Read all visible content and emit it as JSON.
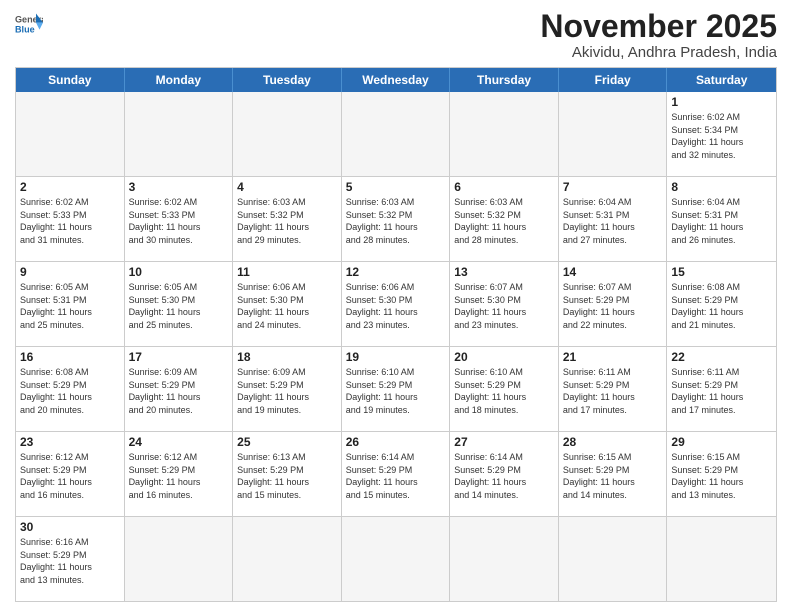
{
  "header": {
    "logo_general": "General",
    "logo_blue": "Blue",
    "month_title": "November 2025",
    "location": "Akividu, Andhra Pradesh, India"
  },
  "day_headers": [
    "Sunday",
    "Monday",
    "Tuesday",
    "Wednesday",
    "Thursday",
    "Friday",
    "Saturday"
  ],
  "weeks": [
    {
      "days": [
        {
          "num": "",
          "info": "",
          "empty": true
        },
        {
          "num": "",
          "info": "",
          "empty": true
        },
        {
          "num": "",
          "info": "",
          "empty": true
        },
        {
          "num": "",
          "info": "",
          "empty": true
        },
        {
          "num": "",
          "info": "",
          "empty": true
        },
        {
          "num": "",
          "info": "",
          "empty": true
        },
        {
          "num": "1",
          "info": "Sunrise: 6:02 AM\nSunset: 5:34 PM\nDaylight: 11 hours\nand 32 minutes."
        }
      ]
    },
    {
      "days": [
        {
          "num": "2",
          "info": "Sunrise: 6:02 AM\nSunset: 5:33 PM\nDaylight: 11 hours\nand 31 minutes."
        },
        {
          "num": "3",
          "info": "Sunrise: 6:02 AM\nSunset: 5:33 PM\nDaylight: 11 hours\nand 30 minutes."
        },
        {
          "num": "4",
          "info": "Sunrise: 6:03 AM\nSunset: 5:32 PM\nDaylight: 11 hours\nand 29 minutes."
        },
        {
          "num": "5",
          "info": "Sunrise: 6:03 AM\nSunset: 5:32 PM\nDaylight: 11 hours\nand 28 minutes."
        },
        {
          "num": "6",
          "info": "Sunrise: 6:03 AM\nSunset: 5:32 PM\nDaylight: 11 hours\nand 28 minutes."
        },
        {
          "num": "7",
          "info": "Sunrise: 6:04 AM\nSunset: 5:31 PM\nDaylight: 11 hours\nand 27 minutes."
        },
        {
          "num": "8",
          "info": "Sunrise: 6:04 AM\nSunset: 5:31 PM\nDaylight: 11 hours\nand 26 minutes."
        }
      ]
    },
    {
      "days": [
        {
          "num": "9",
          "info": "Sunrise: 6:05 AM\nSunset: 5:31 PM\nDaylight: 11 hours\nand 25 minutes."
        },
        {
          "num": "10",
          "info": "Sunrise: 6:05 AM\nSunset: 5:30 PM\nDaylight: 11 hours\nand 25 minutes."
        },
        {
          "num": "11",
          "info": "Sunrise: 6:06 AM\nSunset: 5:30 PM\nDaylight: 11 hours\nand 24 minutes."
        },
        {
          "num": "12",
          "info": "Sunrise: 6:06 AM\nSunset: 5:30 PM\nDaylight: 11 hours\nand 23 minutes."
        },
        {
          "num": "13",
          "info": "Sunrise: 6:07 AM\nSunset: 5:30 PM\nDaylight: 11 hours\nand 23 minutes."
        },
        {
          "num": "14",
          "info": "Sunrise: 6:07 AM\nSunset: 5:29 PM\nDaylight: 11 hours\nand 22 minutes."
        },
        {
          "num": "15",
          "info": "Sunrise: 6:08 AM\nSunset: 5:29 PM\nDaylight: 11 hours\nand 21 minutes."
        }
      ]
    },
    {
      "days": [
        {
          "num": "16",
          "info": "Sunrise: 6:08 AM\nSunset: 5:29 PM\nDaylight: 11 hours\nand 20 minutes."
        },
        {
          "num": "17",
          "info": "Sunrise: 6:09 AM\nSunset: 5:29 PM\nDaylight: 11 hours\nand 20 minutes."
        },
        {
          "num": "18",
          "info": "Sunrise: 6:09 AM\nSunset: 5:29 PM\nDaylight: 11 hours\nand 19 minutes."
        },
        {
          "num": "19",
          "info": "Sunrise: 6:10 AM\nSunset: 5:29 PM\nDaylight: 11 hours\nand 19 minutes."
        },
        {
          "num": "20",
          "info": "Sunrise: 6:10 AM\nSunset: 5:29 PM\nDaylight: 11 hours\nand 18 minutes."
        },
        {
          "num": "21",
          "info": "Sunrise: 6:11 AM\nSunset: 5:29 PM\nDaylight: 11 hours\nand 17 minutes."
        },
        {
          "num": "22",
          "info": "Sunrise: 6:11 AM\nSunset: 5:29 PM\nDaylight: 11 hours\nand 17 minutes."
        }
      ]
    },
    {
      "days": [
        {
          "num": "23",
          "info": "Sunrise: 6:12 AM\nSunset: 5:29 PM\nDaylight: 11 hours\nand 16 minutes."
        },
        {
          "num": "24",
          "info": "Sunrise: 6:12 AM\nSunset: 5:29 PM\nDaylight: 11 hours\nand 16 minutes."
        },
        {
          "num": "25",
          "info": "Sunrise: 6:13 AM\nSunset: 5:29 PM\nDaylight: 11 hours\nand 15 minutes."
        },
        {
          "num": "26",
          "info": "Sunrise: 6:14 AM\nSunset: 5:29 PM\nDaylight: 11 hours\nand 15 minutes."
        },
        {
          "num": "27",
          "info": "Sunrise: 6:14 AM\nSunset: 5:29 PM\nDaylight: 11 hours\nand 14 minutes."
        },
        {
          "num": "28",
          "info": "Sunrise: 6:15 AM\nSunset: 5:29 PM\nDaylight: 11 hours\nand 14 minutes."
        },
        {
          "num": "29",
          "info": "Sunrise: 6:15 AM\nSunset: 5:29 PM\nDaylight: 11 hours\nand 13 minutes."
        }
      ]
    },
    {
      "days": [
        {
          "num": "30",
          "info": "Sunrise: 6:16 AM\nSunset: 5:29 PM\nDaylight: 11 hours\nand 13 minutes."
        },
        {
          "num": "",
          "info": "",
          "empty": true
        },
        {
          "num": "",
          "info": "",
          "empty": true
        },
        {
          "num": "",
          "info": "",
          "empty": true
        },
        {
          "num": "",
          "info": "",
          "empty": true
        },
        {
          "num": "",
          "info": "",
          "empty": true
        },
        {
          "num": "",
          "info": "",
          "empty": true
        }
      ]
    }
  ]
}
